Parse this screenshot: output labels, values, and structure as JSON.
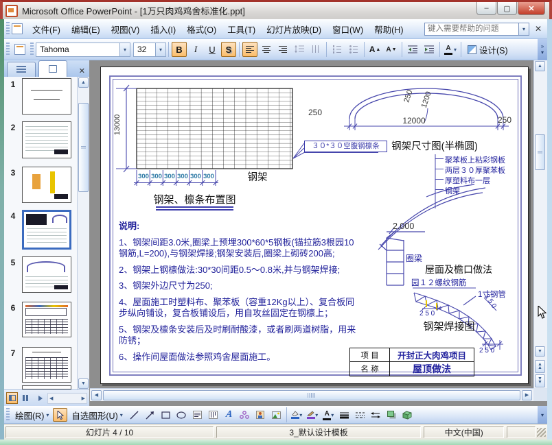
{
  "window": {
    "title": "Microsoft Office PowerPoint - [1万只肉鸡鸡舍标准化.ppt]"
  },
  "icons": {
    "dropdown": "▾",
    "close": "✕",
    "minimize": "–",
    "restore": "▢",
    "up": "▲",
    "down": "▼",
    "left": "◀",
    "right": "▶"
  },
  "menu": {
    "items": [
      "文件(F)",
      "编辑(E)",
      "视图(V)",
      "插入(I)",
      "格式(O)",
      "工具(T)",
      "幻灯片放映(D)",
      "窗口(W)",
      "帮助(H)"
    ],
    "help_placeholder": "键入需要帮助的问题"
  },
  "toolbar": {
    "font_name": "Tahoma",
    "font_size": "32",
    "bold": "B",
    "italic": "I",
    "underline": "U",
    "shadow": "S",
    "font_color": "A",
    "design": "设计(S)",
    "grow": "A",
    "shrink": "A"
  },
  "sidebar": {
    "slide_numbers": [
      "1",
      "2",
      "3",
      "4",
      "5",
      "6",
      "7"
    ],
    "active_slide": "4"
  },
  "drawbar": {
    "draw": "绘图(R)",
    "autoshapes": "自选图形(U)",
    "font_color": "A"
  },
  "statusbar": {
    "slide_indicator": "幻灯片 4 / 10",
    "design_template": "3_默认设计模板",
    "language": "中文(中国)"
  },
  "slide": {
    "layout_title": "钢架、檩条布置图",
    "grid_label": "钢架",
    "dim_13000": "13000",
    "dim_300": [
      "300",
      "300",
      "300",
      "300",
      "300",
      "300"
    ],
    "callout": "３０*３０空腹钢檩条",
    "arch": {
      "title": "钢架尺寸图(半椭圆)",
      "dim_left": "250",
      "dim_right": "250",
      "dim_span": "12000",
      "dim_thick": "250",
      "dim_rise": "1200"
    },
    "layers": [
      "聚苯板上粘彩钢板",
      "两层３０厚聚苯板",
      "厚塑料布一层",
      "钢架"
    ],
    "eave": {
      "title": "屋面及檐口做法",
      "elevation": "2.000",
      "ring_beam": "圈梁"
    },
    "truss": {
      "title": "钢架焊接图",
      "rebar": "园１２螺纹钢筋",
      "pipe": "1寸钢管",
      "dim1": "2 5 0",
      "dim2": "2 5 0",
      "dim3": "2 5 0"
    },
    "info_table": {
      "rows": [
        {
          "label": "项  目",
          "value": "开封正大肉鸡项目"
        },
        {
          "label": "名  称",
          "value": "屋顶做法"
        }
      ]
    },
    "notes": [
      "说明:",
      "1、钢架间距3.0米,圈梁上预埋300*60*5钢板(锚拉筋3根园10钢筋,L=200),与钢架焊接;钢架安装后,圈梁上砌砖200高;",
      "2、钢架上钢檩做法:30*30间距0.5～0.8米,并与钢架焊接;",
      "3、钢架外边尺寸为250;",
      "4、屋面施工时塑料布、聚苯板（容重12Kg以上）、复合板同步纵向铺设，复合板铺设后，用自攻丝固定在钢檩上；",
      "5、钢架及檩条安装后及时刷耐酸漆，或者刷两道树脂，用来防锈；",
      "6、操作间屋面做法参照鸡舍屋面施工。"
    ]
  },
  "colors": {
    "cad_blue": "#4747ac",
    "dim_teal": "#2f7ba6",
    "note_navy": "#1e1e99",
    "selection_orange": "#fbbd6b",
    "titlebar_red": "#b0443a"
  }
}
